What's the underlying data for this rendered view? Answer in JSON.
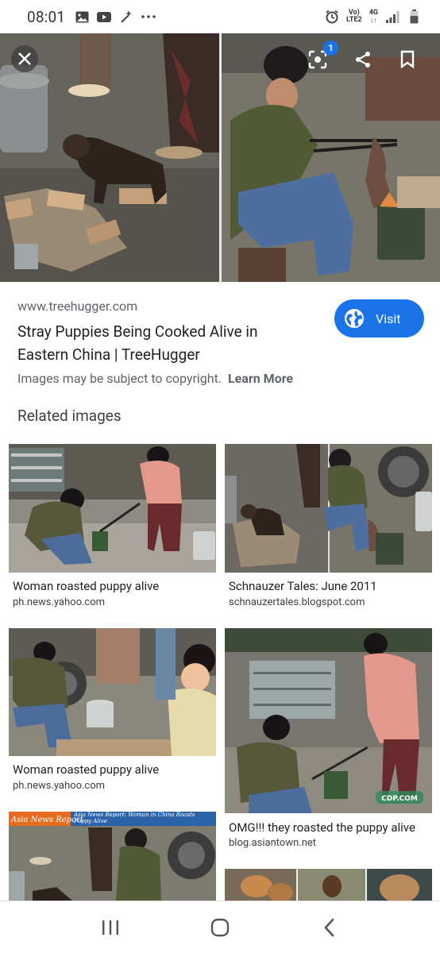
{
  "status_bar": {
    "time": "08:01",
    "left_icons": [
      "gallery-icon",
      "youtube-icon",
      "magic-wand-icon",
      "more-dots-icon"
    ],
    "right_icons": [
      "alarm-icon",
      "volte-icon",
      "signal-icon",
      "battery-icon"
    ],
    "volte_top": "Vo)",
    "volte_bottom": "LTE2",
    "network": "4G"
  },
  "viewer": {
    "lens_badge": "1",
    "buttons": [
      "close-icon",
      "lens-icon",
      "share-icon",
      "bookmark-icon"
    ]
  },
  "result": {
    "domain": "www.treehugger.com",
    "title": "Stray Puppies Being Cooked Alive in Eastern China | TreeHugger",
    "visit_label": "Visit",
    "copyright_text": "Images may be subject to copyright.",
    "learn_more": "Learn More"
  },
  "related": {
    "heading": "Related images",
    "cards": [
      {
        "title": "Woman roasted puppy alive",
        "source": "ph.news.yahoo.com"
      },
      {
        "title": "Schnauzer Tales: June 2011",
        "source": "schnauzertales.blogspot.com"
      },
      {
        "title": "Woman roasted puppy alive",
        "source": "ph.news.yahoo.com"
      },
      {
        "title": "OMG!!! they roasted the puppy alive",
        "source": "blog.asiantown.net"
      }
    ],
    "partial_thumb_caption": "Asia News Report",
    "partial_thumb_sub": "Asia News Report: Woman in China Roasts Puppy Alive",
    "watermark": "CDP.COM"
  },
  "nav_bar": {
    "buttons": [
      "recent-apps-icon",
      "home-icon",
      "back-icon"
    ]
  }
}
